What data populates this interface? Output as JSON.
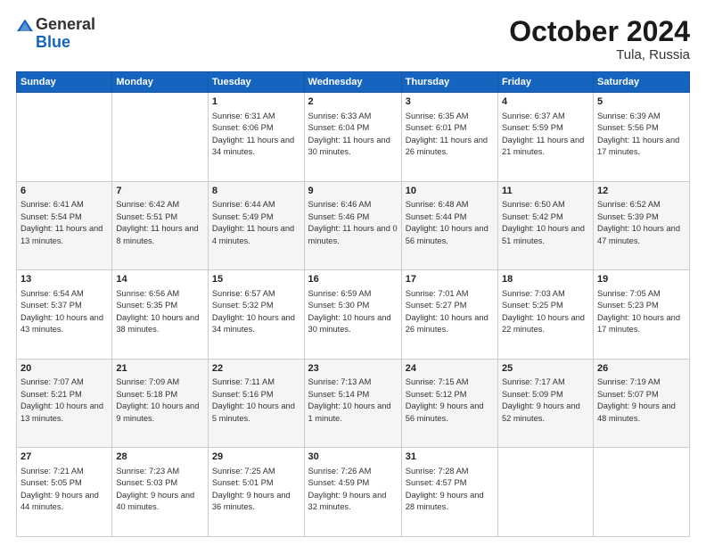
{
  "header": {
    "logo_general": "General",
    "logo_blue": "Blue",
    "month": "October 2024",
    "location": "Tula, Russia"
  },
  "days_of_week": [
    "Sunday",
    "Monday",
    "Tuesday",
    "Wednesday",
    "Thursday",
    "Friday",
    "Saturday"
  ],
  "weeks": [
    [
      {
        "day": "",
        "info": ""
      },
      {
        "day": "",
        "info": ""
      },
      {
        "day": "1",
        "info": "Sunrise: 6:31 AM\nSunset: 6:06 PM\nDaylight: 11 hours and 34 minutes."
      },
      {
        "day": "2",
        "info": "Sunrise: 6:33 AM\nSunset: 6:04 PM\nDaylight: 11 hours and 30 minutes."
      },
      {
        "day": "3",
        "info": "Sunrise: 6:35 AM\nSunset: 6:01 PM\nDaylight: 11 hours and 26 minutes."
      },
      {
        "day": "4",
        "info": "Sunrise: 6:37 AM\nSunset: 5:59 PM\nDaylight: 11 hours and 21 minutes."
      },
      {
        "day": "5",
        "info": "Sunrise: 6:39 AM\nSunset: 5:56 PM\nDaylight: 11 hours and 17 minutes."
      }
    ],
    [
      {
        "day": "6",
        "info": "Sunrise: 6:41 AM\nSunset: 5:54 PM\nDaylight: 11 hours and 13 minutes."
      },
      {
        "day": "7",
        "info": "Sunrise: 6:42 AM\nSunset: 5:51 PM\nDaylight: 11 hours and 8 minutes."
      },
      {
        "day": "8",
        "info": "Sunrise: 6:44 AM\nSunset: 5:49 PM\nDaylight: 11 hours and 4 minutes."
      },
      {
        "day": "9",
        "info": "Sunrise: 6:46 AM\nSunset: 5:46 PM\nDaylight: 11 hours and 0 minutes."
      },
      {
        "day": "10",
        "info": "Sunrise: 6:48 AM\nSunset: 5:44 PM\nDaylight: 10 hours and 56 minutes."
      },
      {
        "day": "11",
        "info": "Sunrise: 6:50 AM\nSunset: 5:42 PM\nDaylight: 10 hours and 51 minutes."
      },
      {
        "day": "12",
        "info": "Sunrise: 6:52 AM\nSunset: 5:39 PM\nDaylight: 10 hours and 47 minutes."
      }
    ],
    [
      {
        "day": "13",
        "info": "Sunrise: 6:54 AM\nSunset: 5:37 PM\nDaylight: 10 hours and 43 minutes."
      },
      {
        "day": "14",
        "info": "Sunrise: 6:56 AM\nSunset: 5:35 PM\nDaylight: 10 hours and 38 minutes."
      },
      {
        "day": "15",
        "info": "Sunrise: 6:57 AM\nSunset: 5:32 PM\nDaylight: 10 hours and 34 minutes."
      },
      {
        "day": "16",
        "info": "Sunrise: 6:59 AM\nSunset: 5:30 PM\nDaylight: 10 hours and 30 minutes."
      },
      {
        "day": "17",
        "info": "Sunrise: 7:01 AM\nSunset: 5:27 PM\nDaylight: 10 hours and 26 minutes."
      },
      {
        "day": "18",
        "info": "Sunrise: 7:03 AM\nSunset: 5:25 PM\nDaylight: 10 hours and 22 minutes."
      },
      {
        "day": "19",
        "info": "Sunrise: 7:05 AM\nSunset: 5:23 PM\nDaylight: 10 hours and 17 minutes."
      }
    ],
    [
      {
        "day": "20",
        "info": "Sunrise: 7:07 AM\nSunset: 5:21 PM\nDaylight: 10 hours and 13 minutes."
      },
      {
        "day": "21",
        "info": "Sunrise: 7:09 AM\nSunset: 5:18 PM\nDaylight: 10 hours and 9 minutes."
      },
      {
        "day": "22",
        "info": "Sunrise: 7:11 AM\nSunset: 5:16 PM\nDaylight: 10 hours and 5 minutes."
      },
      {
        "day": "23",
        "info": "Sunrise: 7:13 AM\nSunset: 5:14 PM\nDaylight: 10 hours and 1 minute."
      },
      {
        "day": "24",
        "info": "Sunrise: 7:15 AM\nSunset: 5:12 PM\nDaylight: 9 hours and 56 minutes."
      },
      {
        "day": "25",
        "info": "Sunrise: 7:17 AM\nSunset: 5:09 PM\nDaylight: 9 hours and 52 minutes."
      },
      {
        "day": "26",
        "info": "Sunrise: 7:19 AM\nSunset: 5:07 PM\nDaylight: 9 hours and 48 minutes."
      }
    ],
    [
      {
        "day": "27",
        "info": "Sunrise: 7:21 AM\nSunset: 5:05 PM\nDaylight: 9 hours and 44 minutes."
      },
      {
        "day": "28",
        "info": "Sunrise: 7:23 AM\nSunset: 5:03 PM\nDaylight: 9 hours and 40 minutes."
      },
      {
        "day": "29",
        "info": "Sunrise: 7:25 AM\nSunset: 5:01 PM\nDaylight: 9 hours and 36 minutes."
      },
      {
        "day": "30",
        "info": "Sunrise: 7:26 AM\nSunset: 4:59 PM\nDaylight: 9 hours and 32 minutes."
      },
      {
        "day": "31",
        "info": "Sunrise: 7:28 AM\nSunset: 4:57 PM\nDaylight: 9 hours and 28 minutes."
      },
      {
        "day": "",
        "info": ""
      },
      {
        "day": "",
        "info": ""
      }
    ]
  ]
}
